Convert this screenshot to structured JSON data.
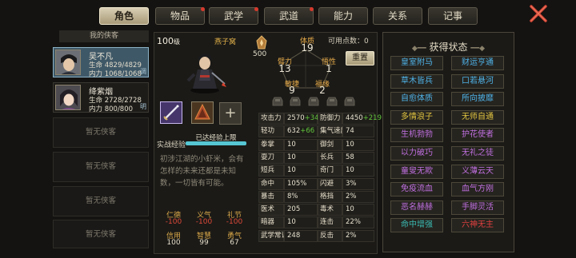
{
  "tabs": [
    {
      "label": "角色",
      "active": true,
      "badge": false
    },
    {
      "label": "物品",
      "active": false,
      "badge": true
    },
    {
      "label": "武学",
      "active": false,
      "badge": true
    },
    {
      "label": "武道",
      "active": false,
      "badge": true
    },
    {
      "label": "能力",
      "active": false,
      "badge": false
    },
    {
      "label": "关系",
      "active": false,
      "badge": false
    },
    {
      "label": "记事",
      "active": false,
      "badge": false
    }
  ],
  "roster": {
    "title": "我的侠客",
    "heroes": [
      {
        "name": "吴不凡",
        "hp_label": "生命",
        "hp": "4829/4829",
        "mp_label": "内力",
        "mp": "1068/1068",
        "tag": "调",
        "selected": true
      },
      {
        "name": "绛紫烟",
        "hp_label": "生命",
        "hp": "2728/2728",
        "mp_label": "内力",
        "mp": "800/800",
        "tag": "明",
        "selected": false
      }
    ],
    "empty_slots": [
      "暂无侠客",
      "暂无侠客",
      "暂无侠客",
      "暂无侠客",
      "暂无侠客"
    ]
  },
  "character": {
    "level": "100",
    "level_unit": "级",
    "nickname": "燕子窝",
    "exp_label": "实战经验",
    "exp_status": "已达经验上限",
    "exp_progress": 1.0,
    "description": "初涉江湖的小虾米，会有怎样的未来还都是未知数，一切皆有可能。",
    "bottom_traits": [
      {
        "label": "仁德",
        "value": "-100",
        "neg": true
      },
      {
        "label": "义气",
        "value": "-100",
        "neg": true
      },
      {
        "label": "礼节",
        "value": "-100",
        "neg": true
      },
      {
        "label": "信用",
        "value": "100",
        "neg": false
      },
      {
        "label": "智慧",
        "value": "99",
        "neg": false
      },
      {
        "label": "勇气",
        "value": "67",
        "neg": false
      }
    ]
  },
  "attributes": {
    "emblem_value": "500",
    "points_label": "可用点数：",
    "points": "0",
    "reset_label": "重置",
    "stats": [
      {
        "label": "体质",
        "value": "19"
      },
      {
        "label": "臂力",
        "value": "13"
      },
      {
        "label": "悟性",
        "value": "1"
      },
      {
        "label": "敏捷",
        "value": "9"
      },
      {
        "label": "福缘",
        "value": "2"
      }
    ]
  },
  "stats_table": [
    {
      "name": "攻击力",
      "value": "2570",
      "bonus": "+340",
      "name2": "防御力",
      "value2": "4450",
      "bonus2": "+219"
    },
    {
      "name": "轻功",
      "value": "632",
      "bonus": "+66",
      "name2": "集气速度",
      "value2": "74",
      "bonus2": ""
    },
    {
      "name": "拳掌",
      "value": "10",
      "bonus": "",
      "name2": "御剑",
      "value2": "10",
      "bonus2": ""
    },
    {
      "name": "耍刀",
      "value": "10",
      "bonus": "",
      "name2": "长兵",
      "value2": "58",
      "bonus2": ""
    },
    {
      "name": "短兵",
      "value": "10",
      "bonus": "",
      "name2": "奇门",
      "value2": "10",
      "bonus2": ""
    },
    {
      "name": "命中",
      "value": "105%",
      "bonus": "",
      "name2": "闪避",
      "value2": "3%",
      "bonus2": ""
    },
    {
      "name": "暴击",
      "value": "8%",
      "bonus": "",
      "name2": "格挡",
      "value2": "2%",
      "bonus2": ""
    },
    {
      "name": "医术",
      "value": "205",
      "bonus": "",
      "name2": "毒术",
      "value2": "10",
      "bonus2": ""
    },
    {
      "name": "暗器",
      "value": "10",
      "bonus": "",
      "name2": "连击",
      "value2": "22%",
      "bonus2": ""
    },
    {
      "name": "武学常识",
      "value": "248",
      "bonus": "",
      "name2": "反击",
      "value2": "2%",
      "bonus2": ""
    }
  ],
  "status_panel": {
    "title": "获得状态",
    "buffs": [
      {
        "label": "皇室附马",
        "color": "#4fb3e8"
      },
      {
        "label": "财运亨通",
        "color": "#4fb3e8"
      },
      {
        "label": "草木皆兵",
        "color": "#4fb3e8"
      },
      {
        "label": "口若悬河",
        "color": "#4fb3e8"
      },
      {
        "label": "自愈体质",
        "color": "#4fb3e8"
      },
      {
        "label": "所向披靡",
        "color": "#4fb3e8"
      },
      {
        "label": "多情浪子",
        "color": "#e0c440"
      },
      {
        "label": "无师自通",
        "color": "#e0c440"
      },
      {
        "label": "生机勃勃",
        "color": "#c070e0"
      },
      {
        "label": "护花使者",
        "color": "#c070e0"
      },
      {
        "label": "以力破巧",
        "color": "#c070e0"
      },
      {
        "label": "无礼之徒",
        "color": "#c070e0"
      },
      {
        "label": "童叟无欺",
        "color": "#c070e0"
      },
      {
        "label": "义薄云天",
        "color": "#c070e0"
      },
      {
        "label": "免疫流血",
        "color": "#c070e0"
      },
      {
        "label": "血气方刚",
        "color": "#c070e0"
      },
      {
        "label": "恶名赫赫",
        "color": "#c070e0"
      },
      {
        "label": "手脚灵活",
        "color": "#c070e0"
      },
      {
        "label": "命中增强",
        "color": "#39b8b0"
      },
      {
        "label": "六神无主",
        "color": "#e04040"
      }
    ]
  }
}
